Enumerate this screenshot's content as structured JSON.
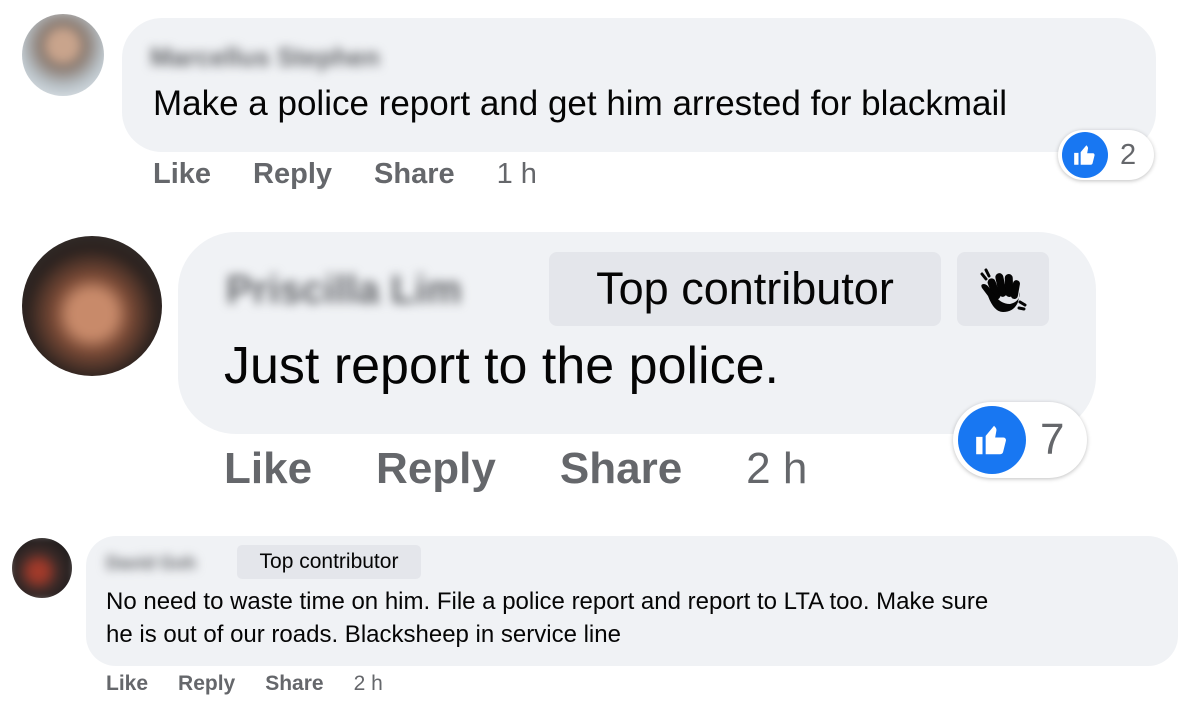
{
  "colors": {
    "bubble_bg": "#f0f2f5",
    "badge_bg": "#e4e6eb",
    "meta_text": "#65676b",
    "like_blue": "#1877f2"
  },
  "comments": [
    {
      "author": "Marcellus Stephen",
      "text": "Make a police report and get him arrested for blackmail",
      "actions": {
        "like": "Like",
        "reply": "Reply",
        "share": "Share"
      },
      "time": "1 h",
      "reaction_icon": "thumbs-up-icon",
      "reaction_count": "2"
    },
    {
      "author": "Priscilla Lim",
      "badge": "Top contributor",
      "badge_icon": "waving-hand-icon",
      "text": "Just report to the police.",
      "actions": {
        "like": "Like",
        "reply": "Reply",
        "share": "Share"
      },
      "time": "2 h",
      "reaction_icon": "thumbs-up-icon",
      "reaction_count": "7"
    },
    {
      "author": "David Goh",
      "badge": "Top contributor",
      "text_line1": "No need to waste time on him. File a police report and report to LTA too. Make sure",
      "text_line2": "he is out of our roads. Blacksheep in service line",
      "actions": {
        "like": "Like",
        "reply": "Reply",
        "share": "Share"
      },
      "time": "2 h"
    }
  ]
}
